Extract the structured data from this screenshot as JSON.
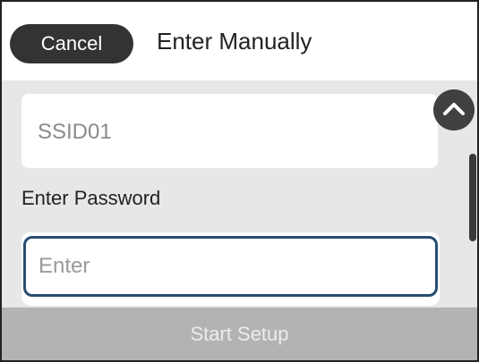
{
  "header": {
    "cancel_label": "Cancel",
    "title": "Enter Manually"
  },
  "ssid": {
    "value": "SSID01"
  },
  "password": {
    "label": "Enter Password",
    "placeholder": "Enter"
  },
  "footer": {
    "start_label": "Start Setup"
  },
  "icons": {
    "scroll_up": "chevron-up-icon"
  },
  "colors": {
    "header_button": "#333333",
    "content_background": "#e7e7e7",
    "input_border": "#274d71",
    "footer_background": "#b3b3b3",
    "footer_text": "#ececec"
  }
}
